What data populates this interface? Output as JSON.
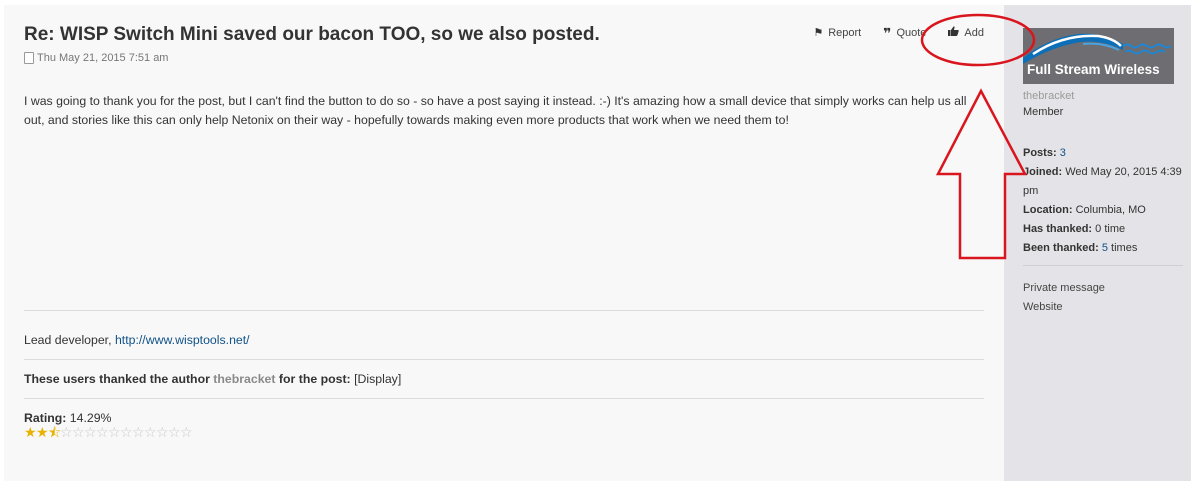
{
  "post": {
    "title": "Re: WISP Switch Mini saved our bacon TOO, so we also posted.",
    "timestamp": "Thu May 21, 2015 7:51 am",
    "actions": {
      "report": "Report",
      "quote": "Quote",
      "add": "Add"
    },
    "body": "I was going to thank you for the post, but I can't find the button to do so - so have a post saying it instead. :-) It's amazing how a small device that simply works can help us all out, and stories like this can only help Netonix on their way - hopefully towards making even more products that work when we need them to!",
    "signature": {
      "prefix": "Lead developer, ",
      "link": "http://www.wisptools.net/"
    },
    "thanks": {
      "prefix": "These users thanked the author",
      "author": "thebracket",
      "suffix": "for the post:",
      "display": "[Display]"
    },
    "rating": {
      "label": "Rating:",
      "value": "14.29%",
      "fraction": 0.1429,
      "max_stars": 14
    }
  },
  "profile": {
    "logo_text": "Full Stream Wireless",
    "username": "thebracket",
    "rank": "Member",
    "posts_label": "Posts:",
    "posts_value": "3",
    "joined_label": "Joined:",
    "joined_value": "Wed May 20, 2015 4:39 pm",
    "location_label": "Location:",
    "location_value": "Columbia, MO",
    "has_thanked_label": "Has thanked:",
    "has_thanked_value": "0 time",
    "been_thanked_label": "Been thanked:",
    "been_thanked_count": "5",
    "been_thanked_suffix": "times",
    "private_message": "Private message",
    "website": "Website"
  },
  "colors": {
    "annotation": "#d9151d",
    "link": "#105289",
    "star": "#e9b200"
  },
  "icons": {
    "report": "flag-icon",
    "quote": "quote-icon",
    "add": "thumbs-up-icon"
  }
}
